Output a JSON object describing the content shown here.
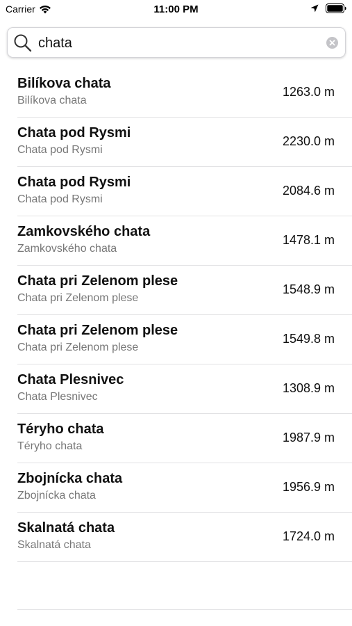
{
  "status_bar": {
    "carrier": "Carrier",
    "time": "11:00 PM"
  },
  "search": {
    "value": "chata",
    "placeholder": ""
  },
  "results": [
    {
      "title": "Bilíkova chata",
      "subtitle": "Bilíkova chata",
      "elevation": "1263.0 m"
    },
    {
      "title": "Chata pod Rysmi",
      "subtitle": "Chata pod Rysmi",
      "elevation": "2230.0 m"
    },
    {
      "title": "Chata pod Rysmi",
      "subtitle": "Chata pod Rysmi",
      "elevation": "2084.6 m"
    },
    {
      "title": "Zamkovského chata",
      "subtitle": "Zamkovského chata",
      "elevation": "1478.1 m"
    },
    {
      "title": "Chata pri Zelenom plese",
      "subtitle": "Chata pri Zelenom plese",
      "elevation": "1548.9 m"
    },
    {
      "title": "Chata pri Zelenom plese",
      "subtitle": "Chata pri Zelenom plese",
      "elevation": "1549.8 m"
    },
    {
      "title": "Chata Plesnivec",
      "subtitle": "Chata Plesnivec",
      "elevation": "1308.9 m"
    },
    {
      "title": "Téryho chata",
      "subtitle": "Téryho chata",
      "elevation": "1987.9 m"
    },
    {
      "title": "Zbojnícka chata",
      "subtitle": "Zbojnícka chata",
      "elevation": "1956.9 m"
    },
    {
      "title": "Skalnatá chata",
      "subtitle": "Skalnatá chata",
      "elevation": "1724.0 m"
    }
  ],
  "icons": {
    "wifi": "wifi-icon",
    "location": "location-arrow-icon",
    "battery": "battery-icon",
    "search": "search-icon",
    "clear": "clear-icon"
  },
  "colors": {
    "background": "#ffffff",
    "subtitle": "#777777",
    "separator": "#e2e2e4"
  }
}
